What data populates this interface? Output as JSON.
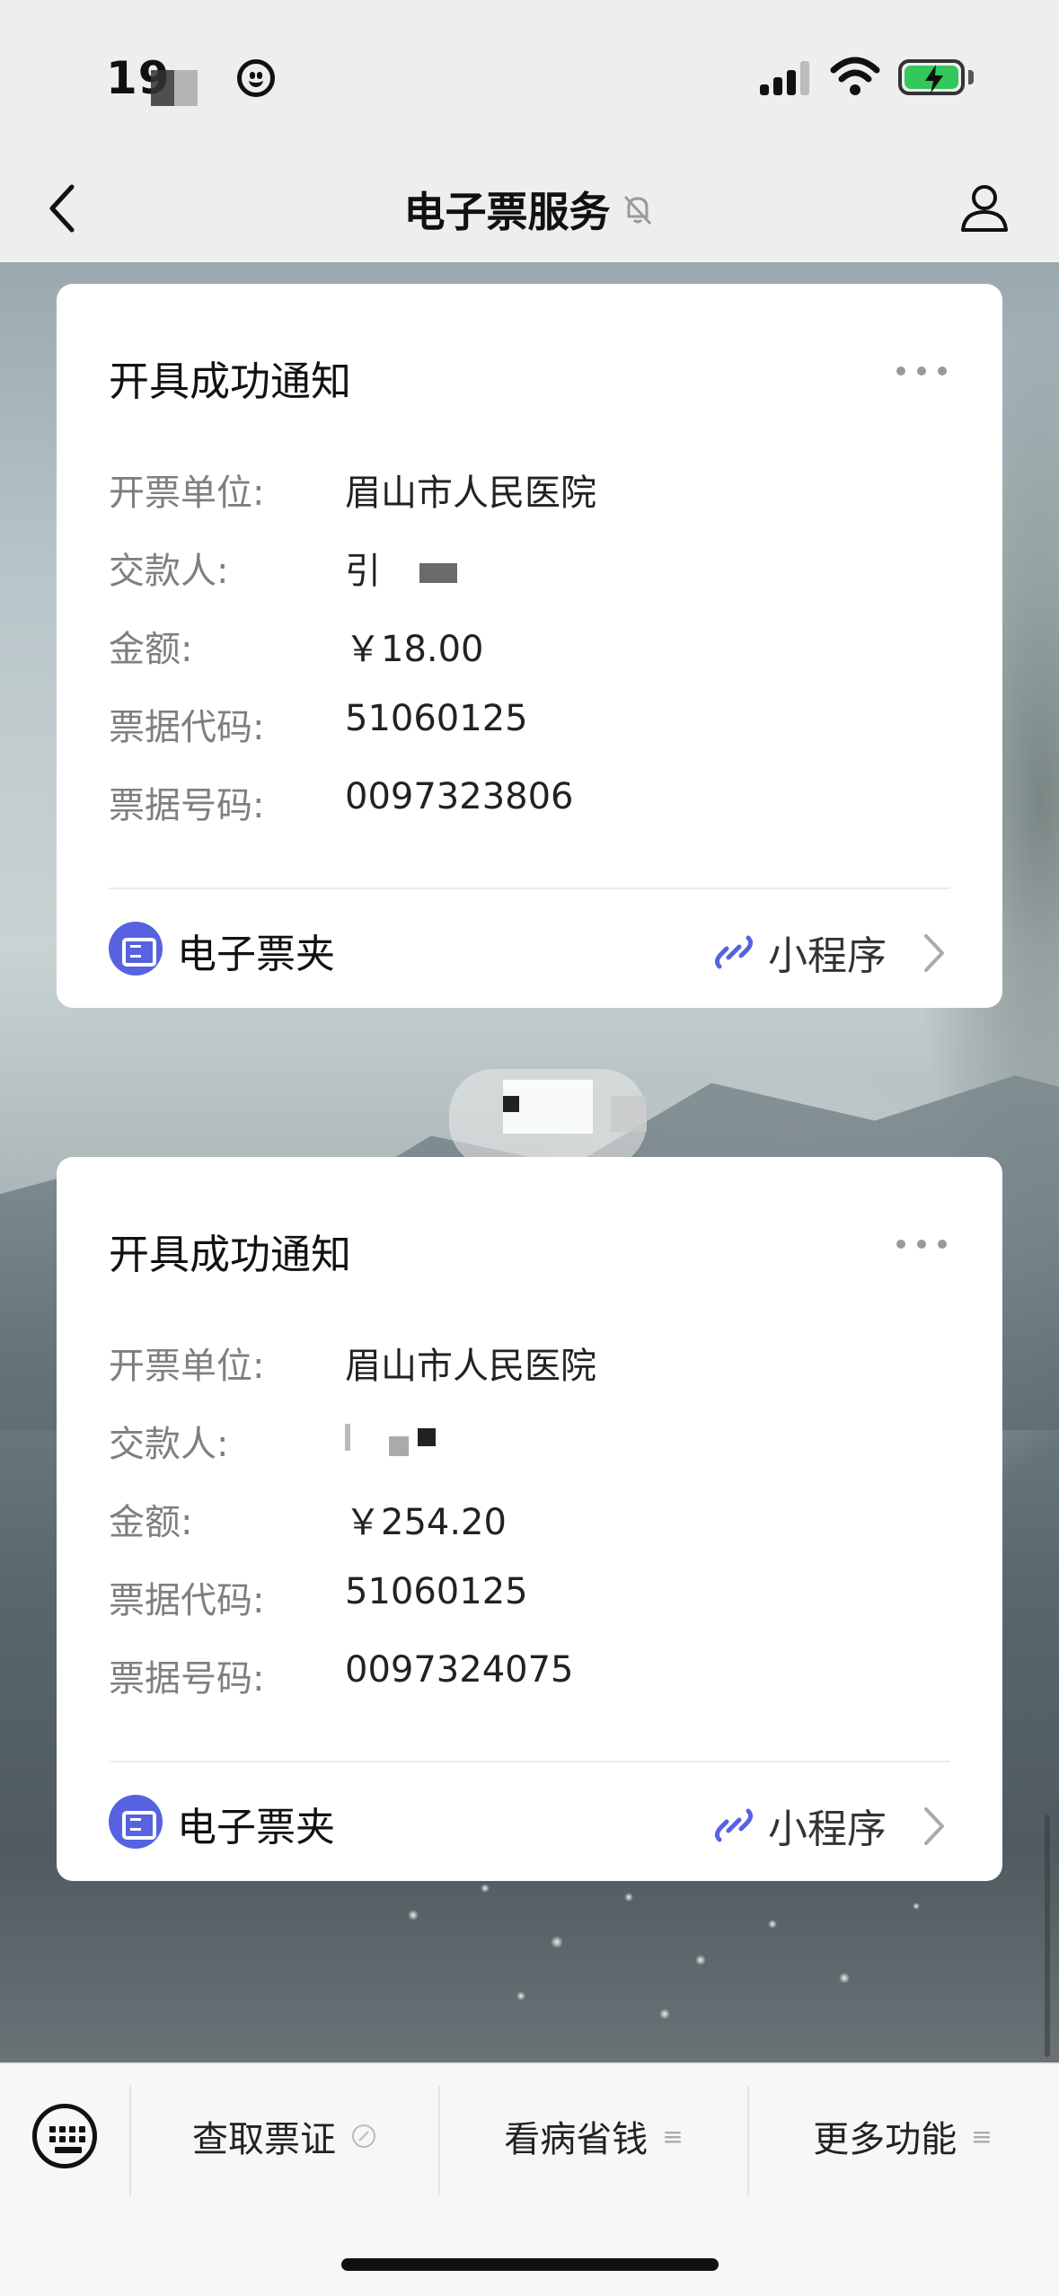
{
  "status_bar": {
    "time": "19",
    "battery_color": "#34c759"
  },
  "nav": {
    "title": "电子票服务",
    "back_icon": "chevron-left-icon",
    "mute_icon": "bell-slash-icon",
    "profile_icon": "person-icon"
  },
  "cards": [
    {
      "title": "开具成功通知",
      "fields": [
        {
          "label": "开票单位:",
          "value": "眉山市人民医院"
        },
        {
          "label": "交款人:",
          "value": "引"
        },
        {
          "label": "金额:",
          "value": "￥18.00"
        },
        {
          "label": "票据代码:",
          "value": "51060125"
        },
        {
          "label": "票据号码:",
          "value": "0097323806"
        }
      ],
      "wallet_label": "电子票夹",
      "miniapp_label": "小程序"
    },
    {
      "title": "开具成功通知",
      "fields": [
        {
          "label": "开票单位:",
          "value": "眉山市人民医院"
        },
        {
          "label": "交款人:",
          "value": ""
        },
        {
          "label": "金额:",
          "value": "￥254.20"
        },
        {
          "label": "票据代码:",
          "value": "51060125"
        },
        {
          "label": "票据号码:",
          "value": "0097324075"
        }
      ],
      "wallet_label": "电子票夹",
      "miniapp_label": "小程序"
    }
  ],
  "bottom_menu": {
    "items": [
      {
        "label": "查取票证",
        "icon": "link-icon"
      },
      {
        "label": "看病省钱",
        "icon": "list-icon"
      },
      {
        "label": "更多功能",
        "icon": "list-icon"
      }
    ],
    "accent_color": "#5662e0"
  }
}
